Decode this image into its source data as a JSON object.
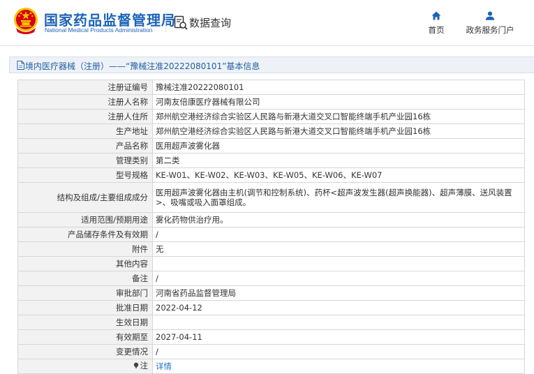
{
  "header": {
    "brand_cn": "国家药品监督管理局",
    "brand_en": "National Medical Products Administration",
    "query_label": "数据查询",
    "nav": {
      "home_label": "首页",
      "service_label": "政务服务门户"
    }
  },
  "breadcrumb": {
    "text": "境内医疗器械（注册）——“豫械注准20222080101”基本信息"
  },
  "detail": {
    "rows": [
      {
        "label": "注册证编号",
        "value": "豫械注准20222080101"
      },
      {
        "label": "注册人名称",
        "value": "河南友倍康医疗器械有限公司"
      },
      {
        "label": "注册人住所",
        "value": "郑州航空港经济综合实验区人民路与新港大道交叉口智能终端手机产业园16栋"
      },
      {
        "label": "生产地址",
        "value": "郑州航空港经济综合实验区人民路与新港大道交叉口智能终端手机产业园16栋"
      },
      {
        "label": "产品名称",
        "value": "医用超声波雾化器"
      },
      {
        "label": "管理类别",
        "value": "第二类"
      },
      {
        "label": "型号规格",
        "value": "KE-W01、KE-W02、KE-W03、KE-W05、KE-W06、KE-W07"
      },
      {
        "label": "结构及组成/主要组成成分",
        "value": "医用超声波雾化器由主机(调节和控制系统)、药杯<超声波发生器(超声换能器)、超声薄膜、送风装置>、吸嘴或吸入面罩组成。"
      },
      {
        "label": "适用范围/预期用途",
        "value": "雾化药物供治疗用。"
      },
      {
        "label": "产品储存条件及有效期",
        "value": "/"
      },
      {
        "label": "附件",
        "value": "无"
      },
      {
        "label": "其他内容",
        "value": ""
      },
      {
        "label": "备注",
        "value": "/"
      },
      {
        "label": "审批部门",
        "value": "河南省药品监督管理局"
      },
      {
        "label": "批准日期",
        "value": "2022-04-12"
      },
      {
        "label": "生效日期",
        "value": ""
      },
      {
        "label": "有效期至",
        "value": "2027-04-11"
      },
      {
        "label": "变更情况",
        "value": "/"
      },
      {
        "label": "注",
        "value": "详情"
      }
    ]
  },
  "colors": {
    "brand_blue": "#1c63b8",
    "link_blue": "#1a6fd1",
    "emblem_red": "#d7000f",
    "emblem_gold": "#f5c400"
  }
}
